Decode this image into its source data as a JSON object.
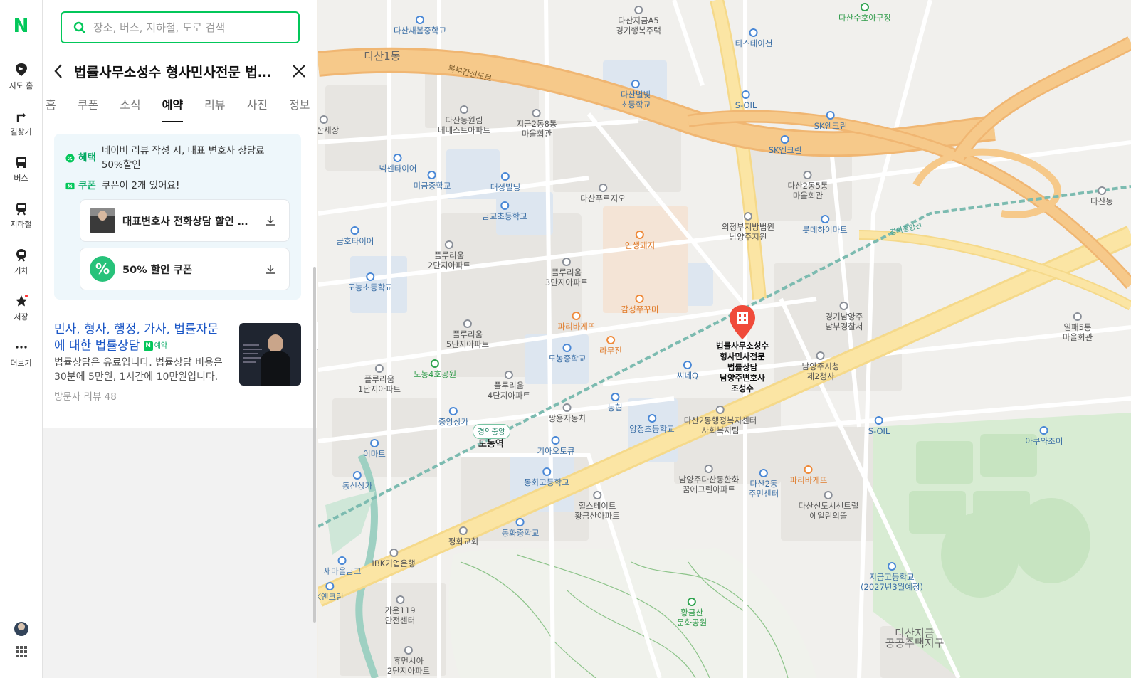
{
  "nav": {
    "logo": "N",
    "items": [
      {
        "label": "지도 홈",
        "icon": "map-home-icon"
      },
      {
        "label": "길찾기",
        "icon": "directions-icon"
      },
      {
        "label": "버스",
        "icon": "bus-icon"
      },
      {
        "label": "지하철",
        "icon": "subway-icon"
      },
      {
        "label": "기차",
        "icon": "train-icon"
      },
      {
        "label": "저장",
        "icon": "star-icon"
      },
      {
        "label": "더보기",
        "icon": "more-icon"
      }
    ]
  },
  "search": {
    "placeholder": "장소, 버스, 지하철, 도로 검색"
  },
  "place": {
    "title": "법률사무소성수 형사민사전문 법률상담 남양주변호사 조성수",
    "tabs": [
      "홈",
      "쿠폰",
      "소식",
      "예약",
      "리뷰",
      "사진",
      "정보"
    ],
    "active_tab": "예약",
    "benefit": {
      "tag": "혜택",
      "text": "네이버 리뷰 작성 시, 대표 변호사 상담료 50%할인"
    },
    "coupon_info": {
      "tag": "쿠폰",
      "text": "쿠폰이 2개 있어요!"
    },
    "coupons": [
      {
        "label": "대표변호사 전화상담 할인 쿠폰"
      },
      {
        "label": "50% 할인 쿠폰"
      }
    ],
    "coupon_pct_symbol": "%",
    "booking_item": {
      "title": "민사, 형사, 행정, 가사, 법률자문에 대한 법률상담",
      "badge": "예약",
      "badge_letter": "N",
      "description": "법률상담은 유료입니다. 법률상담 비용은 30분에 5만원, 1시간에 10만원입니다.",
      "reviews": "방문자 리뷰 48"
    }
  },
  "map": {
    "marker_label": [
      "법률사무소성수",
      "형사민사전문",
      "법률상담",
      "남양주변호사",
      "조성수"
    ],
    "station_line": "경의중앙",
    "station_name": "도농역",
    "places": [
      {
        "name": "다산새봄중학교",
        "kind": "blue"
      },
      {
        "name": "다산지금A5\n경기행복주택",
        "kind": "gray"
      },
      {
        "name": "다산수호아구장",
        "kind": "green"
      },
      {
        "name": "티스테이션",
        "kind": "blue"
      },
      {
        "name": "다산1동",
        "kind": "big"
      },
      {
        "name": "북부간선도로",
        "kind": "road"
      },
      {
        "name": "다산별빛\n초등학교",
        "kind": "blue"
      },
      {
        "name": "S-OIL",
        "kind": "blue"
      },
      {
        "name": "SK엔크린",
        "kind": "blue"
      },
      {
        "name": "SK엔크린",
        "kind": "blue"
      },
      {
        "name": "다산동원림\n베네스트아파트",
        "kind": "gray"
      },
      {
        "name": "지금2동8통\n마을회관",
        "kind": "gray"
      },
      {
        "name": "넥센타이어",
        "kind": "blue"
      },
      {
        "name": "미금중학교",
        "kind": "blue"
      },
      {
        "name": "대성빌딩",
        "kind": "blue"
      },
      {
        "name": "다산푸르지오",
        "kind": "gray"
      },
      {
        "name": "다산2동5통\n마을회관",
        "kind": "gray"
      },
      {
        "name": "금교초등학교",
        "kind": "blue"
      },
      {
        "name": "롯데하이마트",
        "kind": "blue"
      },
      {
        "name": "의정부지방법원\n남양주지원",
        "kind": "gray"
      },
      {
        "name": "금호타이어",
        "kind": "blue"
      },
      {
        "name": "인생돼지",
        "kind": "orange"
      },
      {
        "name": "플루리움\n2단지아파트",
        "kind": "gray"
      },
      {
        "name": "플루리움\n3단지아파트",
        "kind": "gray"
      },
      {
        "name": "도농초등학교",
        "kind": "blue"
      },
      {
        "name": "감성쭈꾸미",
        "kind": "orange"
      },
      {
        "name": "경기남양주\n남부경찰서",
        "kind": "gray"
      },
      {
        "name": "일패5통\n마을회관",
        "kind": "gray"
      },
      {
        "name": "파리바게뜨",
        "kind": "orange"
      },
      {
        "name": "플루리움\n5단지아파트",
        "kind": "gray"
      },
      {
        "name": "라무진",
        "kind": "orange"
      },
      {
        "name": "도농중학교",
        "kind": "blue"
      },
      {
        "name": "도농4호공원",
        "kind": "green"
      },
      {
        "name": "씨네Q",
        "kind": "blue"
      },
      {
        "name": "남양주시청\n제2청사",
        "kind": "gray"
      },
      {
        "name": "플루리움\n1단지아파트",
        "kind": "gray"
      },
      {
        "name": "플루리움\n4단지아파트",
        "kind": "gray"
      },
      {
        "name": "농협",
        "kind": "blue"
      },
      {
        "name": "중앙상가",
        "kind": "blue"
      },
      {
        "name": "쌍용자동차",
        "kind": "gray"
      },
      {
        "name": "양정초등학교",
        "kind": "blue"
      },
      {
        "name": "다산2동행정복지센터\n사회복지팀",
        "kind": "gray"
      },
      {
        "name": "S-OIL",
        "kind": "blue"
      },
      {
        "name": "아쿠와조이",
        "kind": "blue"
      },
      {
        "name": "이마트",
        "kind": "blue"
      },
      {
        "name": "기아오토큐",
        "kind": "blue"
      },
      {
        "name": "동신상가",
        "kind": "blue"
      },
      {
        "name": "동화고등학교",
        "kind": "blue"
      },
      {
        "name": "남양주다산동한화\n꿈에그린아파트",
        "kind": "gray"
      },
      {
        "name": "다산2동\n주민센터",
        "kind": "blue"
      },
      {
        "name": "파리바게뜨",
        "kind": "orange"
      },
      {
        "name": "힐스테이트\n황금산아파트",
        "kind": "gray"
      },
      {
        "name": "다산신도시센트럴\n에일린의뜰",
        "kind": "gray"
      },
      {
        "name": "동화중학교",
        "kind": "blue"
      },
      {
        "name": "평화교회",
        "kind": "gray"
      },
      {
        "name": "IBK기업은행",
        "kind": "gray"
      },
      {
        "name": "새마을금고",
        "kind": "blue"
      },
      {
        "name": "지금고등학교\n(2027년3월예정)",
        "kind": "blue"
      },
      {
        "name": "K엔크린",
        "kind": "blue"
      },
      {
        "name": "가운119\n안전센터",
        "kind": "gray"
      },
      {
        "name": "황금산\n문화공원",
        "kind": "green"
      },
      {
        "name": "다산지금\n공공주택지구",
        "kind": "big"
      },
      {
        "name": "휴먼시아\n2단지아파트",
        "kind": "gray"
      },
      {
        "name": "다산세상",
        "kind": "gray"
      },
      {
        "name": "경의중앙선",
        "kind": "rail"
      },
      {
        "name": "다산동",
        "kind": "gray"
      }
    ]
  },
  "colors": {
    "brand": "#03c75a",
    "marker": "#f04b3a",
    "link": "#1a56c6",
    "benefit_bg": "#eef7fb"
  }
}
